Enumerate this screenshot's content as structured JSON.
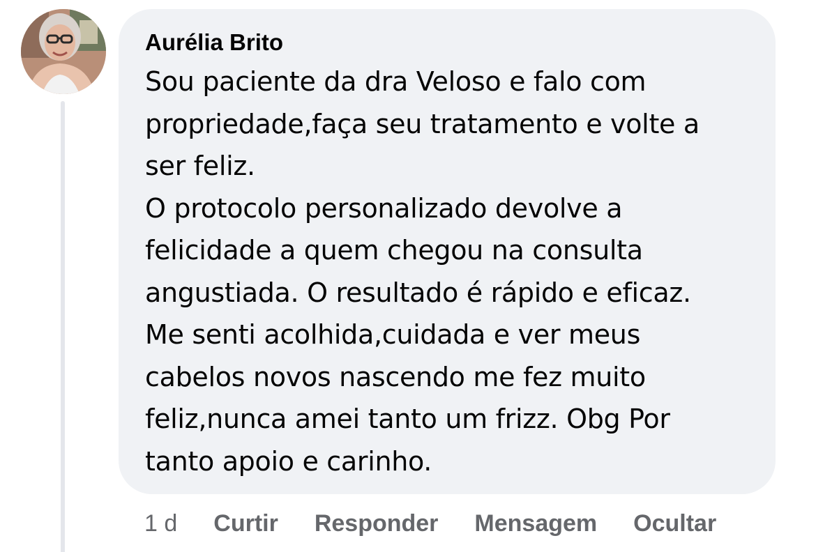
{
  "comment": {
    "author": "Aurélia Brito",
    "body_lines": [
      "Sou paciente da dra Veloso e falo com",
      "propriedade,faça seu tratamento e volte a",
      "ser feliz.",
      "O protocolo personalizado devolve a",
      "felicidade a quem chegou na consulta",
      "angustiada. O resultado é rápido e eficaz.",
      "Me senti acolhida,cuidada e ver meus",
      "cabelos novos nascendo me fez muito",
      "feliz,nunca amei tanto um frizz. Obg Por",
      "tanto apoio e carinho."
    ],
    "timestamp": "1 d",
    "actions": {
      "like": "Curtir",
      "reply": "Responder",
      "message": "Mensagem",
      "hide": "Ocultar"
    }
  },
  "colors": {
    "bubble": "#f0f2f5",
    "text": "#050505",
    "secondary_text": "#65676b",
    "thread_line": "#e4e6eb"
  },
  "icons": {
    "avatar": "user-profile-photo"
  }
}
